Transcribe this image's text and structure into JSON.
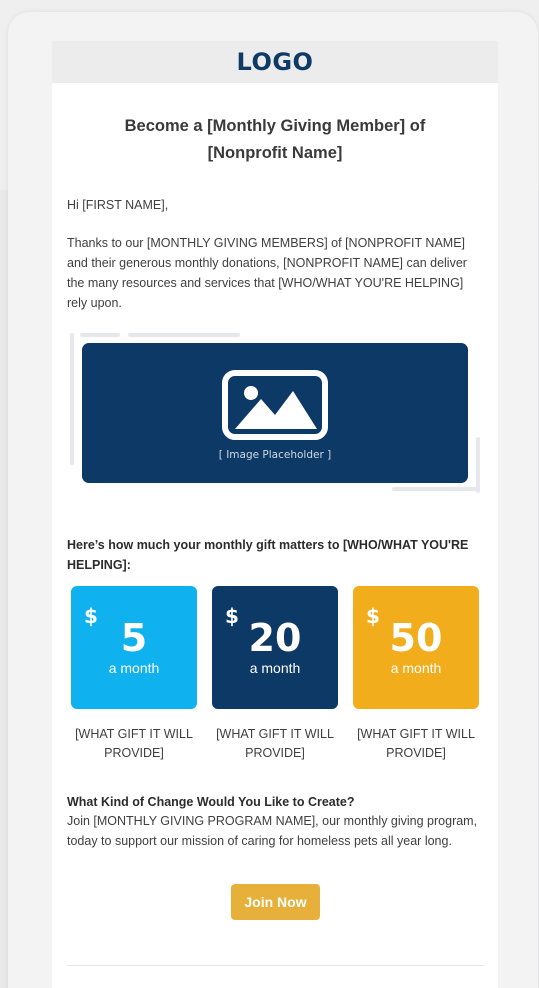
{
  "colors": {
    "navy": "#0d3966",
    "light_blue": "#0fb1ef",
    "gold": "#f1ad1c",
    "button": "#e6b03a"
  },
  "header": {
    "logo": "LOGO"
  },
  "email": {
    "title": "Become a [Monthly Giving Member] of [Nonprofit Name]",
    "greeting": "Hi [FIRST NAME],",
    "intro": "Thanks to our [MONTHLY GIVING MEMBERS] of [NONPROFIT NAME] and their generous monthly donations, [NONPROFIT NAME] can deliver the many resources and services that [WHO/WHAT YOU'RE HELPING] rely upon.",
    "image": {
      "icon": "image-icon",
      "caption": "[ Image Placeholder ]"
    },
    "matters_heading": "Here’s how much your monthly gift matters to [WHO/WHAT YOU'RE HELPING]:",
    "tiers": [
      {
        "currency": "$",
        "amount": "5",
        "frequency": "a month",
        "description": "[WHAT GIFT IT WILL PROVIDE]",
        "color": "#0fb1ef"
      },
      {
        "currency": "$",
        "amount": "20",
        "frequency": "a month",
        "description": "[WHAT GIFT IT WILL PROVIDE]",
        "color": "#0d3966"
      },
      {
        "currency": "$",
        "amount": "50",
        "frequency": "a month",
        "description": "[WHAT GIFT IT WILL PROVIDE]",
        "color": "#f1ad1c"
      }
    ],
    "change_heading": "What Kind of Change Would You Like to Create?",
    "change_body": "Join [MONTHLY GIVING PROGRAM NAME], our monthly giving program, today to support our mission of caring for homeless pets all year long.",
    "cta_label": "Join Now"
  }
}
